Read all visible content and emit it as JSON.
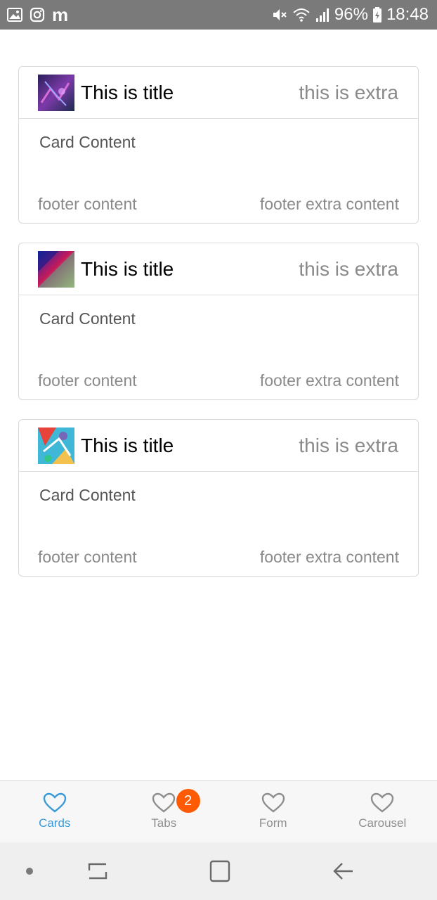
{
  "status_bar": {
    "left_icons": [
      "gallery-icon",
      "instagram-icon"
    ],
    "app_letter": "m",
    "right_icons": [
      "mute-icon",
      "wifi-icon",
      "signal-icon"
    ],
    "battery": "96%",
    "time": "18:48"
  },
  "cards": [
    {
      "title": "This is title",
      "extra": "this is extra",
      "content": "Card Content",
      "footer": "footer content",
      "footer_extra": "footer extra content",
      "thumb": "abstract-purple"
    },
    {
      "title": "This is title",
      "extra": "this is extra",
      "content": "Card Content",
      "footer": "footer content",
      "footer_extra": "footer extra content",
      "thumb": "gradient-red-blue"
    },
    {
      "title": "This is title",
      "extra": "this is extra",
      "content": "Card Content",
      "footer": "footer content",
      "footer_extra": "footer extra content",
      "thumb": "colorful-paint"
    }
  ],
  "tab_bar": {
    "tabs": [
      {
        "label": "Cards",
        "icon": "heart-icon",
        "active": true
      },
      {
        "label": "Tabs",
        "icon": "heart-icon",
        "badge": "2"
      },
      {
        "label": "Form",
        "icon": "heart-icon"
      },
      {
        "label": "Carousel",
        "icon": "heart-icon"
      }
    ]
  },
  "colors": {
    "accent": "#3a9ad9",
    "badge": "#ff5b05",
    "status_bar": "#7a7a7a"
  },
  "nav_bar": {
    "buttons": [
      "dot-icon",
      "recent-apps-icon",
      "home-icon",
      "back-icon"
    ]
  }
}
